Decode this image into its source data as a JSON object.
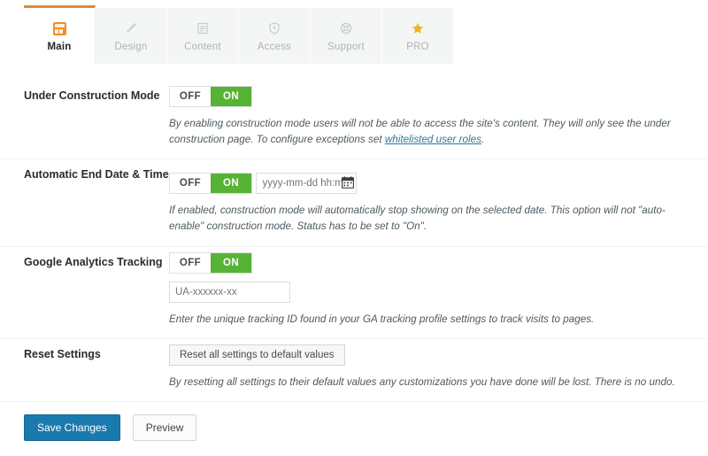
{
  "tabs": [
    {
      "label": "Main",
      "icon": "grid-icon",
      "active": true
    },
    {
      "label": "Design",
      "icon": "brush-icon",
      "active": false
    },
    {
      "label": "Content",
      "icon": "document-icon",
      "active": false
    },
    {
      "label": "Access",
      "icon": "shield-icon",
      "active": false
    },
    {
      "label": "Support",
      "icon": "lifebuoy-icon",
      "active": false
    },
    {
      "label": "PRO",
      "icon": "star-icon",
      "active": false
    }
  ],
  "rows": {
    "under_construction": {
      "label": "Under Construction Mode",
      "toggle": {
        "off": "OFF",
        "on": "ON",
        "state": "ON"
      },
      "desc_part1": "By enabling construction mode users will not be able to access the site's content. They will only see the under construction page. To configure exceptions set ",
      "desc_link": "whitelisted user roles",
      "desc_part2": "."
    },
    "end_date": {
      "label": "Automatic End Date & Time",
      "toggle": {
        "off": "OFF",
        "on": "ON",
        "state": "ON"
      },
      "input_placeholder": "yyyy-mm-dd hh:mm",
      "input_value": "",
      "desc": "If enabled, construction mode will automatically stop showing on the selected date. This option will not \"auto-enable\" construction mode. Status has to be set to \"On\"."
    },
    "analytics": {
      "label": "Google Analytics Tracking",
      "toggle": {
        "off": "OFF",
        "on": "ON",
        "state": "ON"
      },
      "input_placeholder": "UA-xxxxxx-xx",
      "input_value": "",
      "desc": "Enter the unique tracking ID found in your GA tracking profile settings to track visits to pages."
    },
    "reset": {
      "label": "Reset Settings",
      "button_label": "Reset all settings to default values",
      "desc": "By resetting all settings to their default values any customizations you have done will be lost. There is no undo."
    }
  },
  "footer": {
    "save_label": "Save Changes",
    "preview_label": "Preview"
  },
  "colors": {
    "accent_orange": "#e28b32",
    "toggle_on_green": "#56b336",
    "primary_blue": "#1a7aad",
    "link_teal": "#2a7b96",
    "pro_gold": "#f0b323"
  }
}
